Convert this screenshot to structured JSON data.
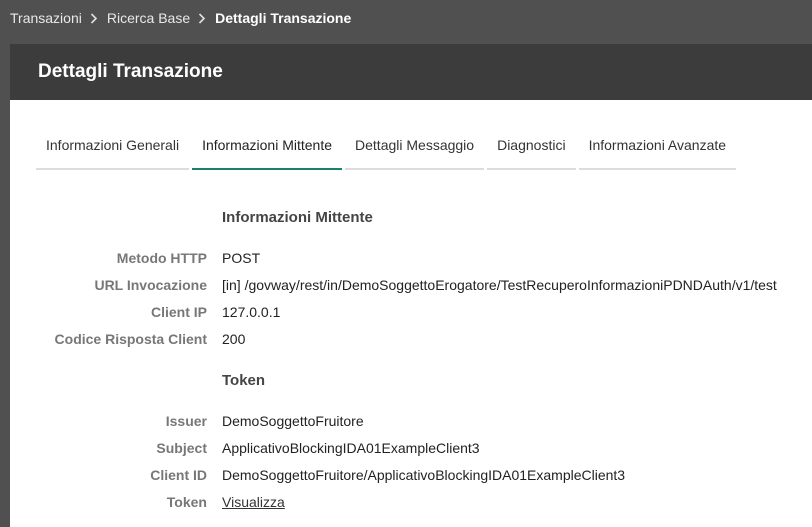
{
  "breadcrumb": {
    "items": [
      "Transazioni",
      "Ricerca Base",
      "Dettagli Transazione"
    ]
  },
  "panel": {
    "title": "Dettagli Transazione"
  },
  "tabs": [
    {
      "label": "Informazioni Generali",
      "active": false
    },
    {
      "label": "Informazioni Mittente",
      "active": true
    },
    {
      "label": "Dettagli Messaggio",
      "active": false
    },
    {
      "label": "Diagnostici",
      "active": false
    },
    {
      "label": "Informazioni Avanzate",
      "active": false
    }
  ],
  "mittente": {
    "title": "Informazioni Mittente",
    "rows": [
      {
        "label": "Metodo HTTP",
        "value": "POST"
      },
      {
        "label": "URL Invocazione",
        "value": "[in] /govway/rest/in/DemoSoggettoErogatore/TestRecuperoInformazioniPDNDAuth/v1/test"
      },
      {
        "label": "Client IP",
        "value": "127.0.0.1"
      },
      {
        "label": "Codice Risposta Client",
        "value": "200"
      }
    ]
  },
  "token": {
    "title": "Token",
    "rows": [
      {
        "label": "Issuer",
        "value": "DemoSoggettoFruitore"
      },
      {
        "label": "Subject",
        "value": "ApplicativoBlockingIDA01ExampleClient3"
      },
      {
        "label": "Client ID",
        "value": "DemoSoggettoFruitore/ApplicativoBlockingIDA01ExampleClient3"
      },
      {
        "label": "Token",
        "value": "Visualizza"
      }
    ]
  },
  "colors": {
    "background": "#505050",
    "header": "#3c3c3c",
    "active_tab": "#1e7f6e"
  },
  "icons": {
    "breadcrumb_separator": "chevron-right-icon"
  }
}
